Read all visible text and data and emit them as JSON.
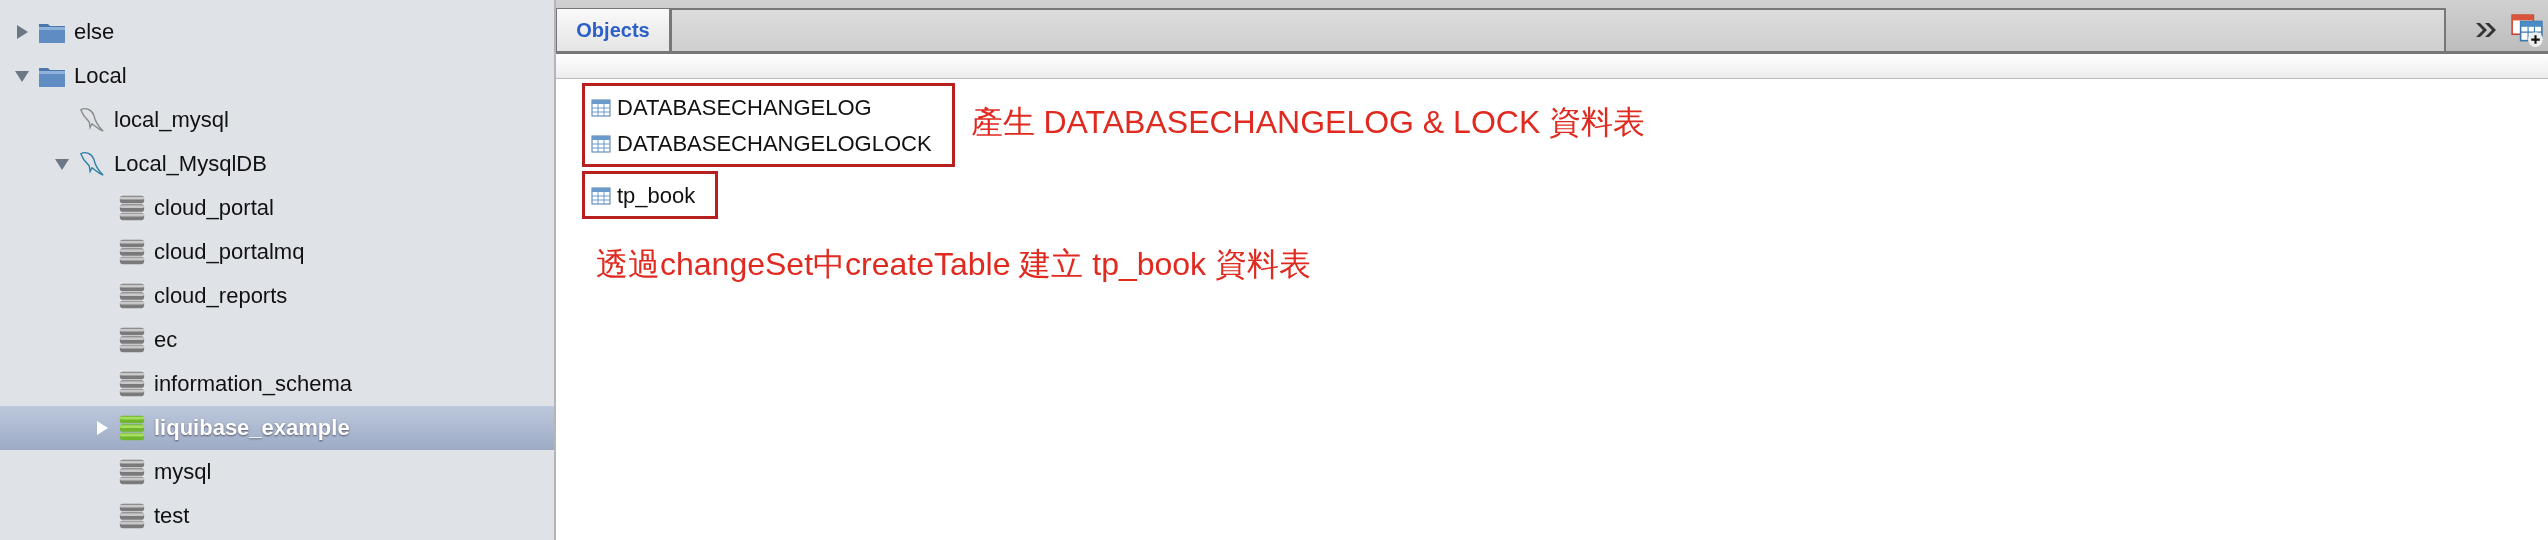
{
  "sidebar": {
    "items": [
      {
        "label": "else",
        "kind": "folder",
        "expanded": false,
        "selected": false
      },
      {
        "label": "Local",
        "kind": "folder",
        "expanded": true,
        "selected": false,
        "children": [
          {
            "label": "local_mysql",
            "kind": "connection",
            "connected": false,
            "selected": false
          },
          {
            "label": "Local_MysqlDB",
            "kind": "connection",
            "connected": true,
            "expanded": true,
            "selected": false,
            "children": [
              {
                "label": "cloud_portal",
                "kind": "database",
                "selected": false
              },
              {
                "label": "cloud_portalmq",
                "kind": "database",
                "selected": false
              },
              {
                "label": "cloud_reports",
                "kind": "database",
                "selected": false
              },
              {
                "label": "ec",
                "kind": "database",
                "selected": false
              },
              {
                "label": "information_schema",
                "kind": "database",
                "selected": false
              },
              {
                "label": "liquibase_example",
                "kind": "database",
                "selected": true,
                "expanded": false
              },
              {
                "label": "mysql",
                "kind": "database",
                "selected": false
              },
              {
                "label": "test",
                "kind": "database",
                "selected": false
              }
            ]
          }
        ]
      }
    ]
  },
  "tabs": [
    {
      "label": "Objects",
      "selected": true
    }
  ],
  "objects": {
    "groups": [
      {
        "tables": [
          "DATABASECHANGELOG",
          "DATABASECHANGELOGLOCK"
        ],
        "note": "產生 DATABASECHANGELOG & LOCK 資料表",
        "kind": "beside"
      },
      {
        "tables": [
          "tp_book"
        ],
        "note": "透過changeSet中createTable 建立 tp_book 資料表",
        "kind": "below"
      }
    ]
  }
}
